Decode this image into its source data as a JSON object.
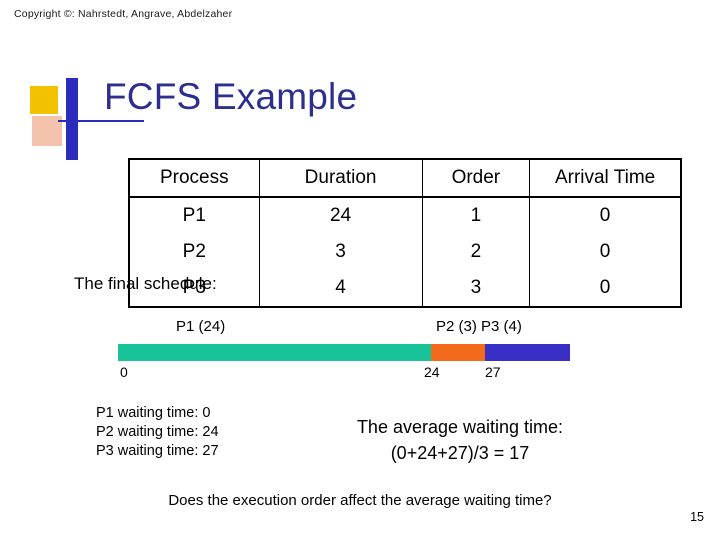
{
  "copyright": "Copyright ©: Nahrstedt, Angrave, Abdelzaher",
  "title": "FCFS Example",
  "table": {
    "headers": [
      "Process",
      "Duration",
      "Order",
      "Arrival Time"
    ],
    "rows": [
      [
        "P1",
        "24",
        "1",
        "0"
      ],
      [
        "P2",
        "3",
        "2",
        "0"
      ],
      [
        "P3",
        "4",
        "3",
        "0"
      ]
    ]
  },
  "final_schedule_label": "The final schedule:",
  "gantt": {
    "label_p1": "P1 (24)",
    "label_p2_p3": "P2 (3)  P3 (4)",
    "tick_start": "0",
    "tick_24": "24",
    "tick_27": "27",
    "color_p1": "#18c39a",
    "color_p2": "#f36a1b",
    "color_p3": "#3a2fc4"
  },
  "waiting": {
    "p1": "P1 waiting time: 0",
    "p2": "P2 waiting time: 24",
    "p3": "P3 waiting time: 27"
  },
  "average": {
    "line1": "The average waiting time:",
    "line2": "(0+24+27)/3 = 17"
  },
  "question": "Does the execution order affect the average waiting time?",
  "slide_number": "15"
}
